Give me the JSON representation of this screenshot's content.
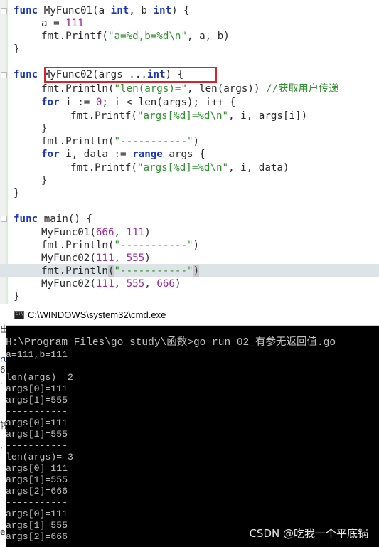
{
  "editor": {
    "func1": {
      "kw_func": "func",
      "name_sig_a": " MyFunc01(a ",
      "kw_int1": "int",
      "sig_mid": ", b ",
      "kw_int2": "int",
      "sig_end": ") {",
      "assign_lhs": "a = ",
      "assign_val": "111",
      "printf_call": "fmt.Printf(",
      "printf_fmt": "\"a=%d,b=%d\\n\"",
      "printf_args": ", a, b)",
      "close": "}"
    },
    "func2": {
      "kw_func": "func",
      "sig_start": " MyFunc02(args ...",
      "kw_int": "int",
      "sig_end": ") {",
      "println_call": "fmt.Println(",
      "println_str": "\"len(args)=\"",
      "println_mid": ", ",
      "kw_len": "len",
      "println_end": "(args)) ",
      "comment": "//获取用户传递",
      "for1_kw": "for",
      "for1_a": " i := ",
      "for1_zero": "0",
      "for1_b": "; i < ",
      "for1_len": "len",
      "for1_c": "(args); i++ {",
      "printf1_call": "fmt.Printf(",
      "printf1_str": "\"args[%d]=%d\\n\"",
      "printf1_end": ", i, args[i])",
      "close_for1": "}",
      "sep_call": "fmt.Println(",
      "sep_str": "\"-----------\"",
      "sep_end": ")",
      "for2_kw": "for",
      "for2_a": " i, data := ",
      "for2_range": "range",
      "for2_b": " args {",
      "printf2_call": "fmt.Printf(",
      "printf2_str": "\"args[%d]=%d\\n\"",
      "printf2_end": ", i, data)",
      "close_for2": "}",
      "close": "}"
    },
    "main": {
      "kw_func": "func",
      "sig": " main() {",
      "call1": "MyFunc01(",
      "call1_a": "666",
      "call1_sep": ", ",
      "call1_b": "111",
      "call1_end": ")",
      "sep1_call": "fmt.Println(",
      "sep1_str": "\"-----------\"",
      "sep1_end": ")",
      "call2": "MyFunc02(",
      "call2_a": "111",
      "call2_sep": ", ",
      "call2_b": "555",
      "call2_end": ")",
      "sep2_call": "fmt.Println",
      "sep2_paren": "(",
      "sep2_str": "\"-----------\"",
      "sep2_end": ")",
      "call3": "MyFunc02(",
      "call3_a": "111",
      "call3_sep1": ", ",
      "call3_b": "555",
      "call3_sep2": ", ",
      "call3_c": "666",
      "call3_end": ")",
      "close": "}"
    }
  },
  "side_chars": [
    "出",
    "ru",
    "60",
    "·",
    "输",
    "·",
    "e"
  ],
  "cmd": {
    "title": "C:\\WINDOWS\\system32\\cmd.exe",
    "icon_text": "C:\\",
    "prompt": "H:\\Program Files\\go_study\\函数>go run 02_有参无返回值.go",
    "lines": [
      "a=111,b=111",
      "-----------",
      "len(args)= 2",
      "args[0]=111",
      "args[1]=555",
      "-----------",
      "args[0]=111",
      "args[1]=555",
      "-----------",
      "len(args)= 3",
      "args[0]=111",
      "args[1]=555",
      "args[2]=666",
      "-----------",
      "args[0]=111",
      "args[1]=555",
      "args[2]=666"
    ],
    "watermark": "CSDN @吃我一个平底锅"
  }
}
